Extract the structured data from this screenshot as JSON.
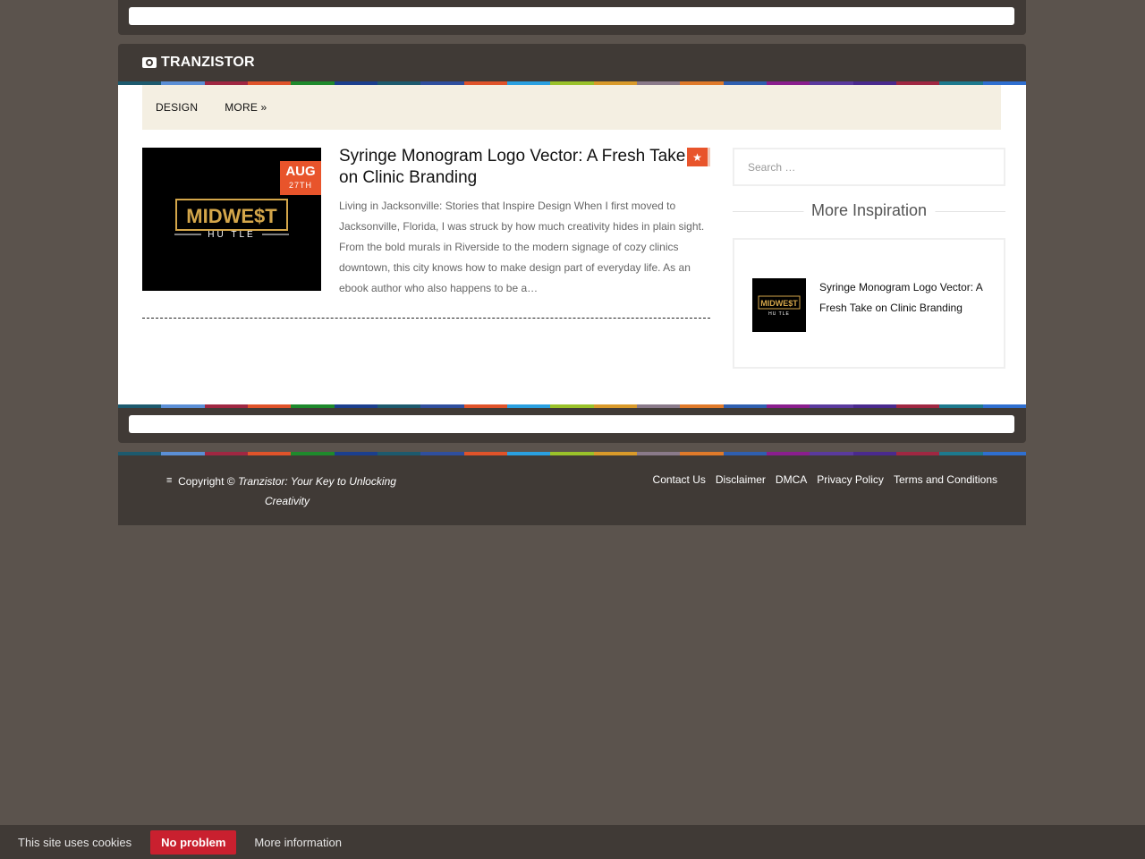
{
  "site": {
    "logo_text": "TRANZISTOR",
    "logo_icon": "camera-icon"
  },
  "nav": {
    "items": [
      {
        "label": "DESIGN"
      },
      {
        "label": "MORE »"
      }
    ]
  },
  "post": {
    "title": "Syringe Monogram Logo Vector: A Fresh Take on Clinic Branding",
    "date_month": "AUG",
    "date_day": "27TH",
    "excerpt": "Living in Jacksonville: Stories that Inspire Design When I first moved to Jacksonville, Florida, I was struck by how much creativity hides in plain sight. From the bold murals in Riverside to the modern signage of cozy clinics downtown, this city knows how to make design part of everyday life. As an ebook author who also happens to be a…",
    "thumb_logo_top": "MIDWE$T",
    "thumb_logo_bottom": "HU TLE",
    "featured_icon": "star-icon"
  },
  "sidebar": {
    "search_placeholder": "Search …",
    "widget_title": "More Inspiration",
    "widget_item": "Syringe Monogram Logo Vector: A Fresh Take on Clinic Branding"
  },
  "footer": {
    "copyright_prefix": "Copyright ©",
    "copyright_site": "Tranzistor: Your Key to Unlocking Creativity",
    "links": [
      "Contact Us",
      "Disclaimer",
      "DMCA",
      "Privacy Policy",
      "Terms and Conditions"
    ]
  },
  "cookie": {
    "text": "This site uses cookies",
    "accept": "No problem",
    "more": "More information"
  },
  "colors": {
    "accent": "#e8542b",
    "cookie_button": "#c9202f",
    "dark": "#403a36",
    "page_bg": "#5b534d",
    "nav_bg": "#f4efe2",
    "stripe": [
      "#1d5a6e",
      "#5b8fd6",
      "#a02742",
      "#e0532a",
      "#1e8a2c",
      "#1b3f8e",
      "#1d5a6e",
      "#2f4f9e",
      "#e0532a",
      "#2aa0e0",
      "#9ac22a",
      "#d99a2a",
      "#8a7a8a",
      "#e07a2a",
      "#2f5fb0",
      "#8a1e8e",
      "#5a3a9e",
      "#4a2a8e",
      "#a02742",
      "#1d7a8e",
      "#2f6fd0"
    ]
  }
}
